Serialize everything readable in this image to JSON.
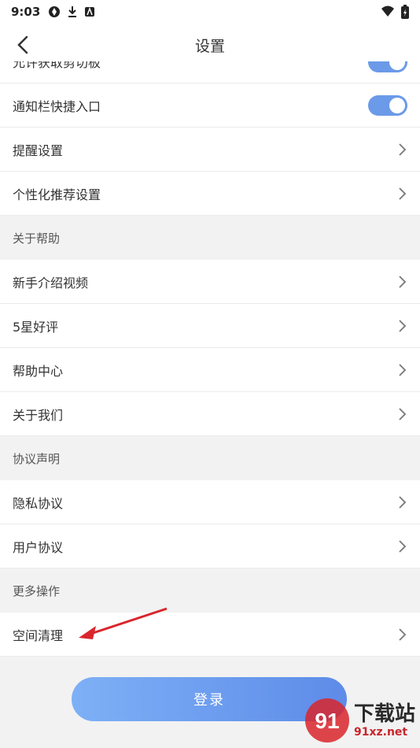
{
  "status_bar": {
    "time": "9:03"
  },
  "header": {
    "title": "设置"
  },
  "rows_top": [
    {
      "label": "允许获取剪切板",
      "type": "toggle",
      "on": true
    },
    {
      "label": "通知栏快捷入口",
      "type": "toggle",
      "on": true
    },
    {
      "label": "提醒设置",
      "type": "chevron"
    },
    {
      "label": "个性化推荐设置",
      "type": "chevron"
    }
  ],
  "sections": {
    "help": {
      "title": "关于帮助",
      "items": [
        "新手介绍视频",
        "5星好评",
        "帮助中心",
        "关于我们"
      ]
    },
    "agreements": {
      "title": "协议声明",
      "items": [
        "隐私协议",
        "用户协议"
      ]
    },
    "more": {
      "title": "更多操作",
      "items": [
        "空间清理"
      ]
    }
  },
  "login_button": {
    "label": "登录"
  },
  "watermark": {
    "text_big": "下载站",
    "text_small": "91xz.net",
    "logo_text": "91"
  },
  "colors": {
    "accent": "#6b9ae8",
    "arrow": "#d9262c",
    "background": "#f2f2f2"
  }
}
